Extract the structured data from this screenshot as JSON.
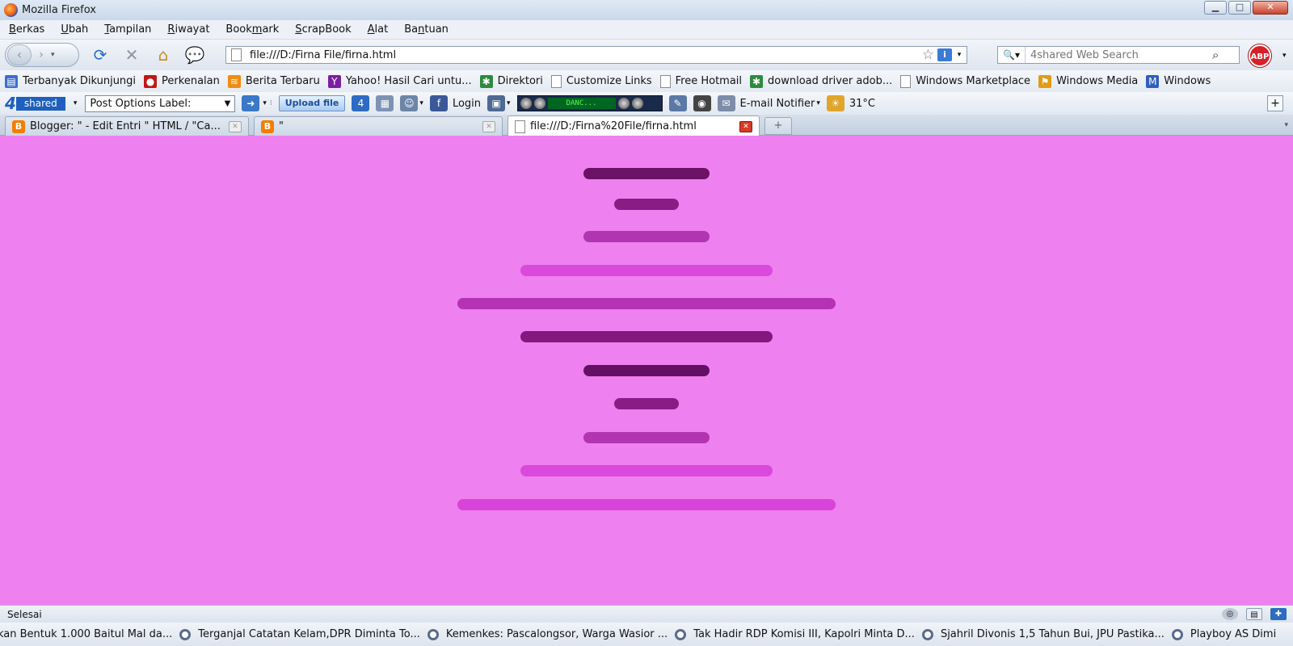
{
  "window": {
    "title": "Mozilla Firefox",
    "controls": {
      "minimize": "▁",
      "maximize": "□",
      "close": "✕"
    }
  },
  "menu": [
    {
      "pre": "",
      "u": "B",
      "post": "erkas"
    },
    {
      "pre": "",
      "u": "U",
      "post": "bah"
    },
    {
      "pre": "",
      "u": "T",
      "post": "ampilan"
    },
    {
      "pre": "",
      "u": "R",
      "post": "iwayat"
    },
    {
      "pre": "Book",
      "u": "m",
      "post": "ark"
    },
    {
      "pre": "",
      "u": "S",
      "post": "crapBook"
    },
    {
      "pre": "",
      "u": "A",
      "post": "lat"
    },
    {
      "pre": "Ba",
      "u": "n",
      "post": "tuan"
    }
  ],
  "nav": {
    "url": "file:///D:/Firna File/firna.html",
    "search_placeholder": "4shared Web Search",
    "abp_label": "ABP",
    "icons": [
      "back-icon",
      "forward-icon",
      "reload-icon",
      "stop-icon",
      "home-icon",
      "chat-icon",
      "star-icon",
      "info-icon",
      "search-icon"
    ]
  },
  "bookmarks": [
    {
      "label": "Terbanyak Dikunjungi",
      "icon": "most-visited-icon",
      "color": "#3b6fd1",
      "glyph": "▤"
    },
    {
      "label": "Perkenalan",
      "icon": "ladybug-icon",
      "color": "#c01818",
      "glyph": "●"
    },
    {
      "label": "Berita Terbaru",
      "icon": "rss-icon",
      "color": "#f08c10",
      "glyph": "≋"
    },
    {
      "label": "Yahoo! Hasil Cari untu...",
      "icon": "yahoo-icon",
      "color": "#7b1fa2",
      "glyph": "Y"
    },
    {
      "label": "Direktori",
      "icon": "google-icon",
      "color": "#2e8b3e",
      "glyph": "✱"
    },
    {
      "label": "Customize Links",
      "icon": "page-icon",
      "color": "#ffffff",
      "glyph": ""
    },
    {
      "label": "Free Hotmail",
      "icon": "page-icon",
      "color": "#ffffff",
      "glyph": ""
    },
    {
      "label": "download driver adob...",
      "icon": "google-icon",
      "color": "#2e8b3e",
      "glyph": "✱"
    },
    {
      "label": "Windows Marketplace",
      "icon": "page-icon",
      "color": "#ffffff",
      "glyph": ""
    },
    {
      "label": "Windows Media",
      "icon": "windows-icon",
      "color": "#e39a16",
      "glyph": "⚑"
    },
    {
      "label": "Windows",
      "icon": "msn-icon",
      "color": "#2f5fbf",
      "glyph": "M"
    }
  ],
  "addon_toolbar": {
    "logo_four": "4",
    "logo_shared": "shared",
    "post_options": "Post Options Label:",
    "upload": "Upload file",
    "login": "Login",
    "player_lcd": "DANC...",
    "email": "E-mail Notifier",
    "weather": "31°C"
  },
  "tabs": [
    {
      "label": "Blogger: \" - Edit Entri \" HTML / \"Ca...",
      "icon": "blogger-icon",
      "active": false
    },
    {
      "label": "\"",
      "icon": "blogger-icon",
      "active": false
    },
    {
      "label": "file:///D:/Firna%20File/firna.html",
      "icon": "page-icon",
      "active": true
    }
  ],
  "content": {
    "background": "#ef80ef",
    "bars": [
      {
        "width": 156,
        "color": "#6b1166"
      },
      {
        "width": 80,
        "color": "#8a1c86"
      },
      {
        "width": 156,
        "color": "#b135b0"
      },
      {
        "width": 312,
        "color": "#db48dc"
      },
      {
        "width": 468,
        "color": "#b532b5"
      },
      {
        "width": 312,
        "color": "#85187f"
      },
      {
        "width": 156,
        "color": "#631064"
      },
      {
        "width": 80,
        "color": "#8a1c86"
      },
      {
        "width": 156,
        "color": "#b135b0"
      },
      {
        "width": 312,
        "color": "#db48dc"
      },
      {
        "width": 468,
        "color": "#d844d9"
      }
    ]
  },
  "status": {
    "text": "Selesai"
  },
  "ticker": [
    "kan Bentuk 1.000 Baitul Mal da...",
    "Terganjal Catatan Kelam,DPR Diminta To...",
    "Kemenkes: Pascalongsor, Warga Wasior ...",
    "Tak Hadir RDP Komisi III, Kapolri Minta D...",
    "Sjahril Divonis 1,5 Tahun Bui, JPU Pastika...",
    "Playboy AS Dimi"
  ]
}
